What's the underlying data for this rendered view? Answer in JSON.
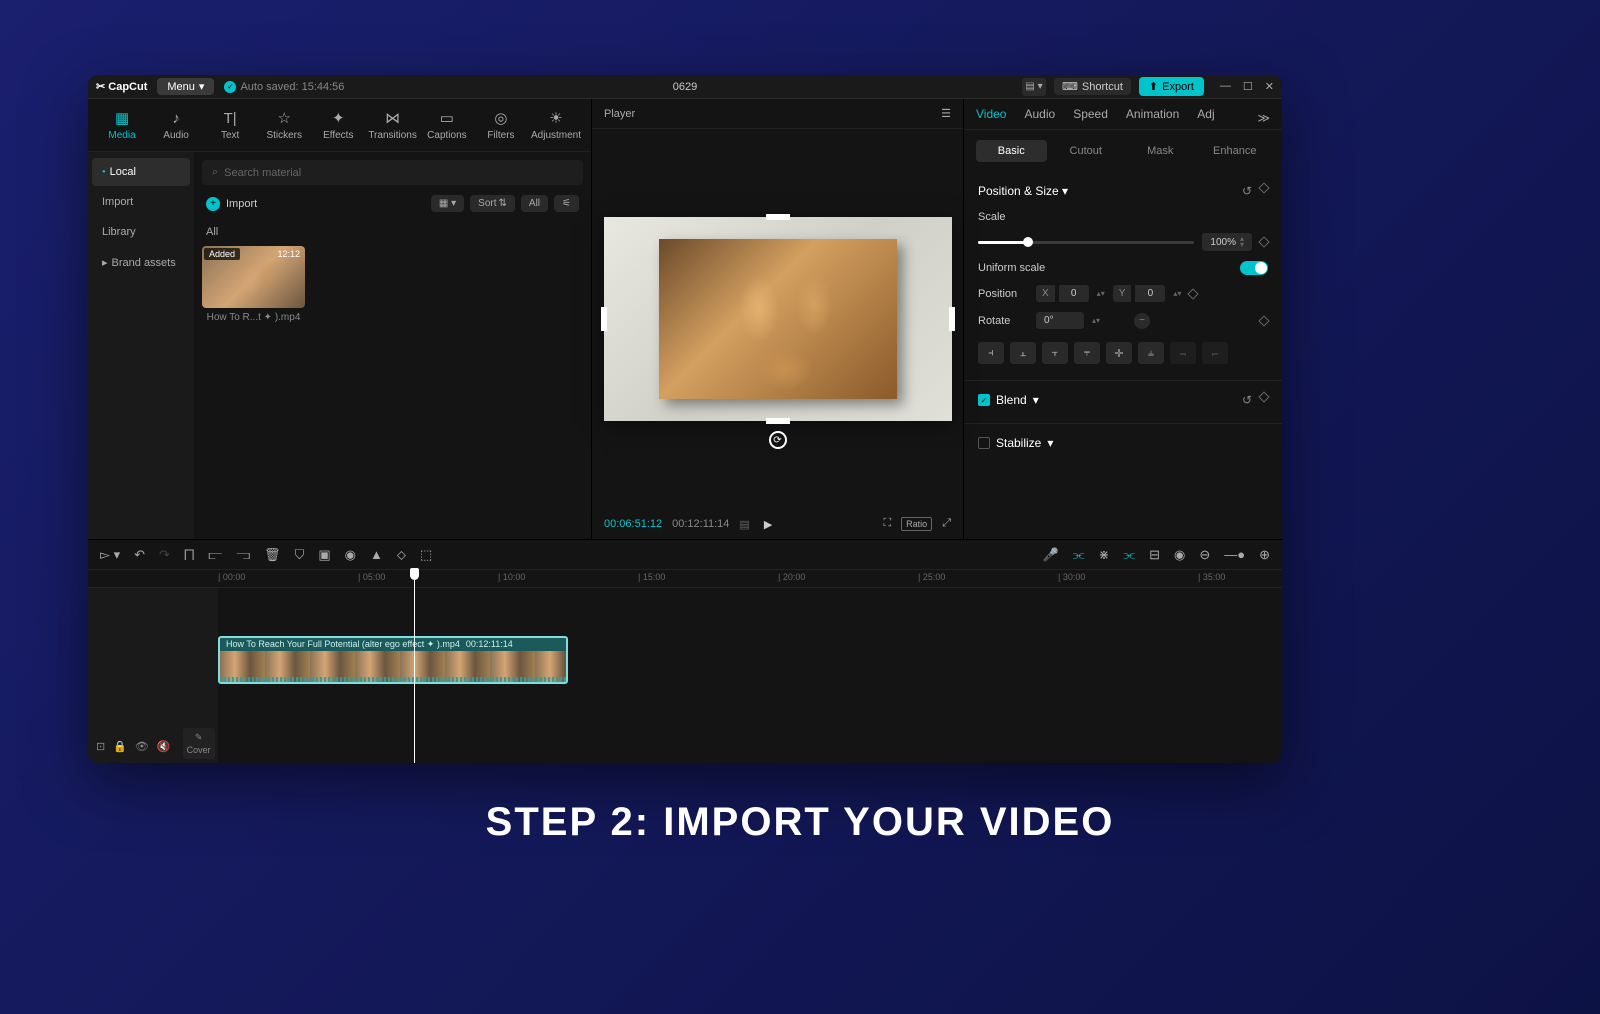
{
  "app": {
    "name": "CapCut",
    "project": "0629"
  },
  "titlebar": {
    "menu": "Menu",
    "autosave": "Auto saved: 15:44:56",
    "shortcut": "Shortcut",
    "export": "Export"
  },
  "tool_tabs": [
    {
      "label": "Media",
      "icon": "▦"
    },
    {
      "label": "Audio",
      "icon": "♪"
    },
    {
      "label": "Text",
      "icon": "T|"
    },
    {
      "label": "Stickers",
      "icon": "☆"
    },
    {
      "label": "Effects",
      "icon": "✦"
    },
    {
      "label": "Transitions",
      "icon": "⋈"
    },
    {
      "label": "Captions",
      "icon": "▭"
    },
    {
      "label": "Filters",
      "icon": "◎"
    },
    {
      "label": "Adjustment",
      "icon": "☀"
    }
  ],
  "side_nav": [
    {
      "label": "Local",
      "prefix": "●"
    },
    {
      "label": "Import",
      "prefix": ""
    },
    {
      "label": "Library",
      "prefix": ""
    },
    {
      "label": "Brand assets",
      "prefix": "▸"
    }
  ],
  "search_placeholder": "Search material",
  "import_label": "Import",
  "view": {
    "sort": "Sort",
    "all": "All"
  },
  "media_filter": "All",
  "media_items": [
    {
      "badge": "Added",
      "duration": "12:12",
      "label": "How To R...t ✦ ).mp4"
    }
  ],
  "preview": {
    "title": "Player",
    "current": "00:06:51:12",
    "total": "00:12:11:14",
    "ratio": "Ratio"
  },
  "props_tabs": [
    "Video",
    "Audio",
    "Speed",
    "Animation",
    "Adj"
  ],
  "sub_tabs": [
    "Basic",
    "Cutout",
    "Mask",
    "Enhance"
  ],
  "props": {
    "section_pos": "Position & Size",
    "scale_label": "Scale",
    "scale_value": "100%",
    "uniform": "Uniform scale",
    "position_label": "Position",
    "pos_x_label": "X",
    "pos_x": "0",
    "pos_y_label": "Y",
    "pos_y": "0",
    "rotate_label": "Rotate",
    "rotate_value": "0°",
    "blend": "Blend",
    "stabilize": "Stabilize"
  },
  "timeline": {
    "ruler": [
      "00:00",
      "05:00",
      "10:00",
      "15:00",
      "20:00",
      "25:00",
      "30:00",
      "35:00"
    ],
    "cover": "Cover",
    "clip_name": "How To Reach Your Full Potential (alter ego effect ✦ ).mp4",
    "clip_duration": "00:12:11:14"
  },
  "caption": "STEP 2: IMPORT YOUR VIDEO"
}
